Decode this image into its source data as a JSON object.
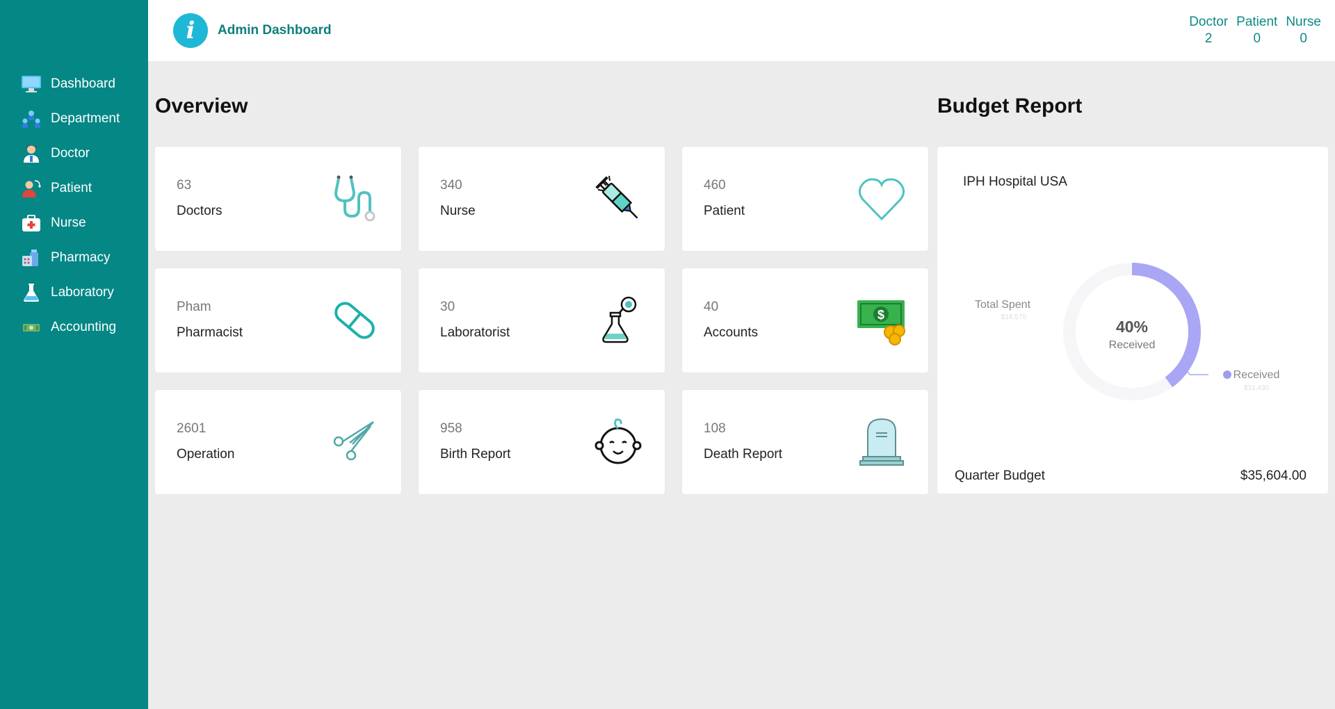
{
  "header": {
    "logo_glyph": "i",
    "brand": "Admin Dashboard",
    "stats": [
      {
        "label": "Doctor",
        "value": "2"
      },
      {
        "label": "Patient",
        "value": "0"
      },
      {
        "label": "Nurse",
        "value": "0"
      }
    ]
  },
  "sidebar": {
    "items": [
      {
        "label": "Dashboard",
        "icon": "monitor-icon"
      },
      {
        "label": "Department",
        "icon": "department-icon"
      },
      {
        "label": "Doctor",
        "icon": "doctor-icon"
      },
      {
        "label": "Patient",
        "icon": "patient-icon"
      },
      {
        "label": "Nurse",
        "icon": "first-aid-kit-icon"
      },
      {
        "label": "Pharmacy",
        "icon": "pharmacy-icon"
      },
      {
        "label": "Laboratory",
        "icon": "flask-icon"
      },
      {
        "label": "Accounting",
        "icon": "cash-icon"
      }
    ]
  },
  "overview": {
    "title": "Overview",
    "cards": [
      {
        "value": "63",
        "label": "Doctors",
        "icon": "stethoscope-icon"
      },
      {
        "value": "340",
        "label": "Nurse",
        "icon": "syringe-icon"
      },
      {
        "value": "460",
        "label": "Patient",
        "icon": "heart-icon"
      },
      {
        "value": "Pham",
        "label": "Pharmacist",
        "icon": "capsule-icon"
      },
      {
        "value": "30",
        "label": "Laboratorist",
        "icon": "lab-flask-icon"
      },
      {
        "value": "40",
        "label": "Accounts",
        "icon": "money-icon"
      },
      {
        "value": "2601",
        "label": "Operation",
        "icon": "scissors-icon"
      },
      {
        "value": "958",
        "label": "Birth Report",
        "icon": "baby-icon"
      },
      {
        "value": "108",
        "label": "Death Report",
        "icon": "tombstone-icon"
      }
    ]
  },
  "budget": {
    "title": "Budget Report",
    "organization": "IPH Hospital USA",
    "quarter_label": "Quarter Budget",
    "quarter_value": "$35,604.00"
  },
  "chart_data": {
    "type": "pie",
    "categories": [
      "Total Spent",
      "Received"
    ],
    "values": [
      18570,
      31430
    ],
    "value_labels": [
      "$18,570",
      "$31,430"
    ],
    "center_value": "40%",
    "center_label": "Received",
    "received_fraction": 0.4,
    "colors": {
      "received": "#a9a6f5",
      "track": "#f6f6f9"
    }
  },
  "colors": {
    "sidebar": "#048785",
    "accent": "#0b8a86",
    "logo": "#1fb7d6",
    "background": "#ececec"
  }
}
